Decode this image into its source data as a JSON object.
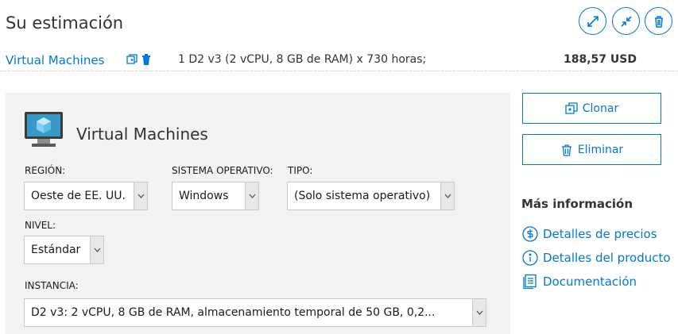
{
  "header": {
    "title": "Su estimación"
  },
  "summary": {
    "product_link": "Virtual Machines",
    "description": "1 D2 v3 (2 vCPU, 8 GB de RAM) x 730 horas;",
    "price": "188,57 USD"
  },
  "panel": {
    "title": "Virtual Machines",
    "fields": {
      "region": {
        "label": "REGIÓN:",
        "value": "Oeste de EE. UU."
      },
      "os": {
        "label": "SISTEMA OPERATIVO:",
        "value": "Windows"
      },
      "type": {
        "label": "TIPO:",
        "value": "(Solo sistema operativo)"
      },
      "tier": {
        "label": "NIVEL:",
        "value": "Estándar"
      },
      "instance": {
        "label": "INSTANCIA:",
        "value": "D2 v3: 2 vCPU, 8 GB de RAM, almacenamiento temporal de 50 GB, 0,2..."
      }
    }
  },
  "actions": {
    "clone_label": "Clonar",
    "delete_label": "Eliminar"
  },
  "more_info": {
    "heading": "Más información",
    "links": [
      {
        "label": "Detalles de precios",
        "icon": "dollar-icon"
      },
      {
        "label": "Detalles del producto",
        "icon": "info-icon"
      },
      {
        "label": "Documentación",
        "icon": "document-icon"
      }
    ]
  },
  "colors": {
    "accent": "#0078d4",
    "panel_bg": "#f2f2f2",
    "vm_icon": "#3999c6"
  }
}
